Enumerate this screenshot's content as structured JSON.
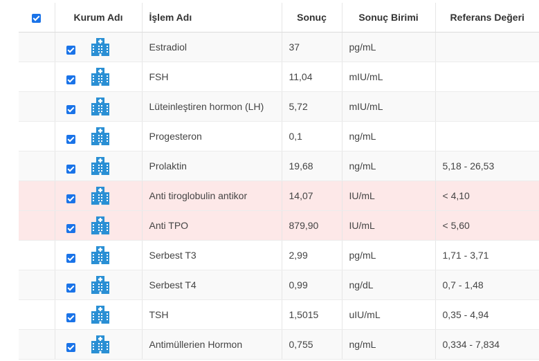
{
  "header": {
    "kurum": "Kurum Adı",
    "islem": "İşlem Adı",
    "sonuc": "Sonuç",
    "birim": "Sonuç Birimi",
    "referans": "Referans Değeri"
  },
  "icons": {
    "checkbox": "checkbox-checked-icon",
    "institution": "hospital-building-icon"
  },
  "colors": {
    "accent": "#1a73e8",
    "icon": "#2a8fd4",
    "danger_row": "#fde8e8"
  },
  "rows": [
    {
      "islem": "Estradiol",
      "sonuc": "37",
      "birim": "pg/mL",
      "referans": "",
      "flag": false
    },
    {
      "islem": "FSH",
      "sonuc": "11,04",
      "birim": "mIU/mL",
      "referans": "",
      "flag": false
    },
    {
      "islem": "Lüteinleştiren hormon (LH)",
      "sonuc": "5,72",
      "birim": "mIU/mL",
      "referans": "",
      "flag": false
    },
    {
      "islem": "Progesteron",
      "sonuc": "0,1",
      "birim": "ng/mL",
      "referans": "",
      "flag": false
    },
    {
      "islem": "Prolaktin",
      "sonuc": "19,68",
      "birim": "ng/mL",
      "referans": "5,18 - 26,53",
      "flag": false
    },
    {
      "islem": "Anti tiroglobulin antikor",
      "sonuc": "14,07",
      "birim": "IU/mL",
      "referans": "< 4,10",
      "flag": true
    },
    {
      "islem": "Anti TPO",
      "sonuc": "879,90",
      "birim": "IU/mL",
      "referans": "< 5,60",
      "flag": true
    },
    {
      "islem": "Serbest T3",
      "sonuc": "2,99",
      "birim": "pg/mL",
      "referans": "1,71 - 3,71",
      "flag": false
    },
    {
      "islem": "Serbest T4",
      "sonuc": "0,99",
      "birim": "ng/dL",
      "referans": "0,7 - 1,48",
      "flag": false
    },
    {
      "islem": "TSH",
      "sonuc": "1,5015",
      "birim": "uIU/mL",
      "referans": "0,35 - 4,94",
      "flag": false
    },
    {
      "islem": "Antimüllerien Hormon",
      "sonuc": "0,755",
      "birim": "ng/mL",
      "referans": "0,334 - 7,834",
      "flag": false
    }
  ]
}
